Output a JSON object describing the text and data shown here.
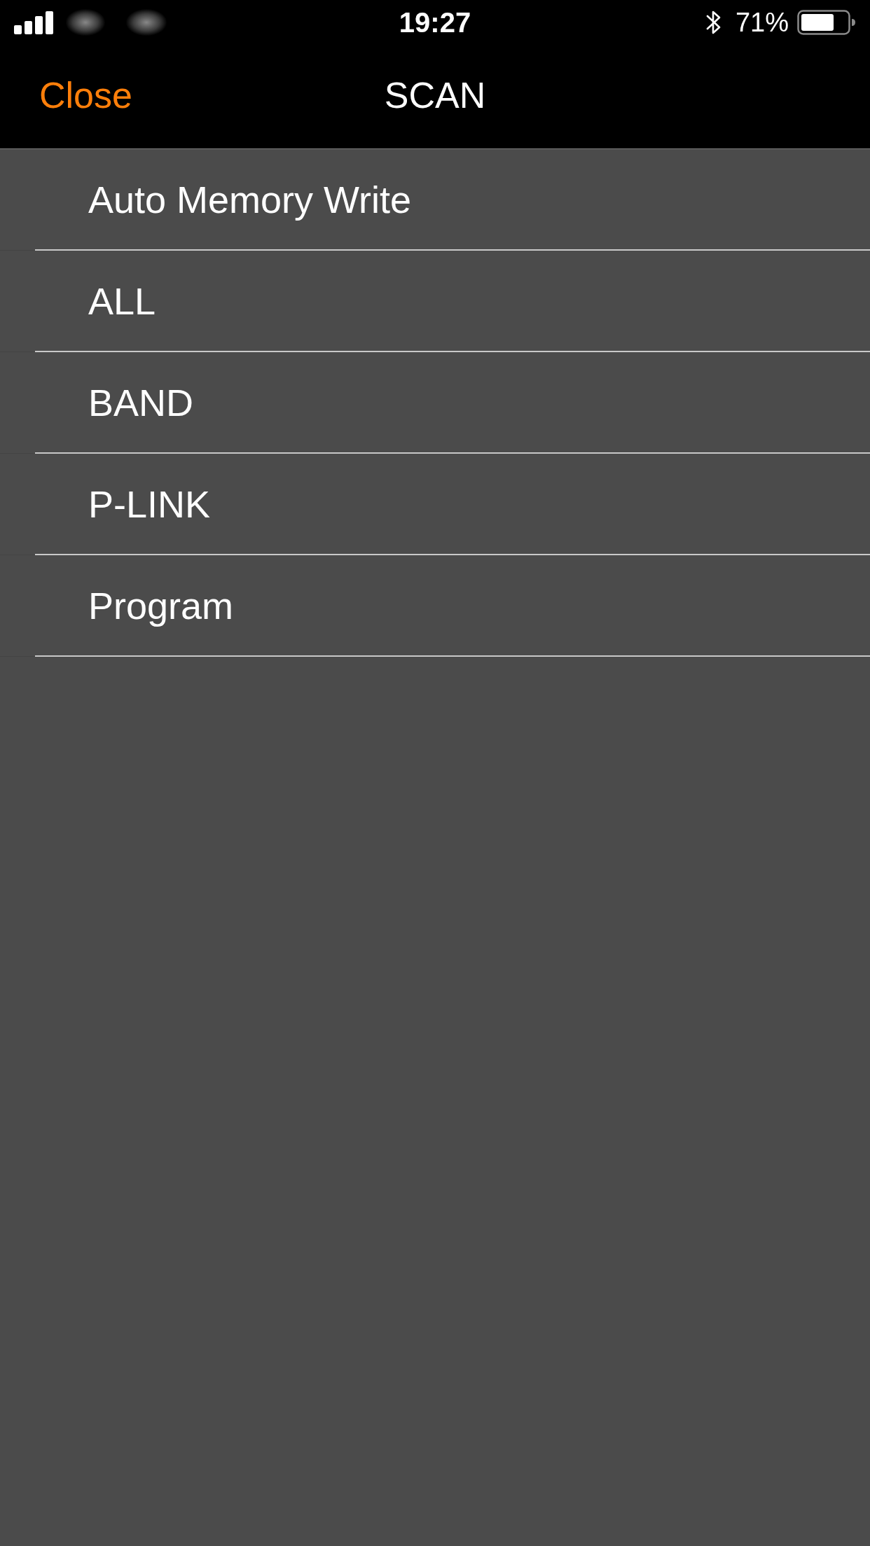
{
  "status_bar": {
    "time": "19:27",
    "battery_percent": "71%"
  },
  "nav_bar": {
    "close": "Close",
    "title": "SCAN"
  },
  "items": [
    {
      "label": "Auto Memory Write"
    },
    {
      "label": "ALL"
    },
    {
      "label": "BAND"
    },
    {
      "label": "P-LINK"
    },
    {
      "label": "Program"
    }
  ]
}
